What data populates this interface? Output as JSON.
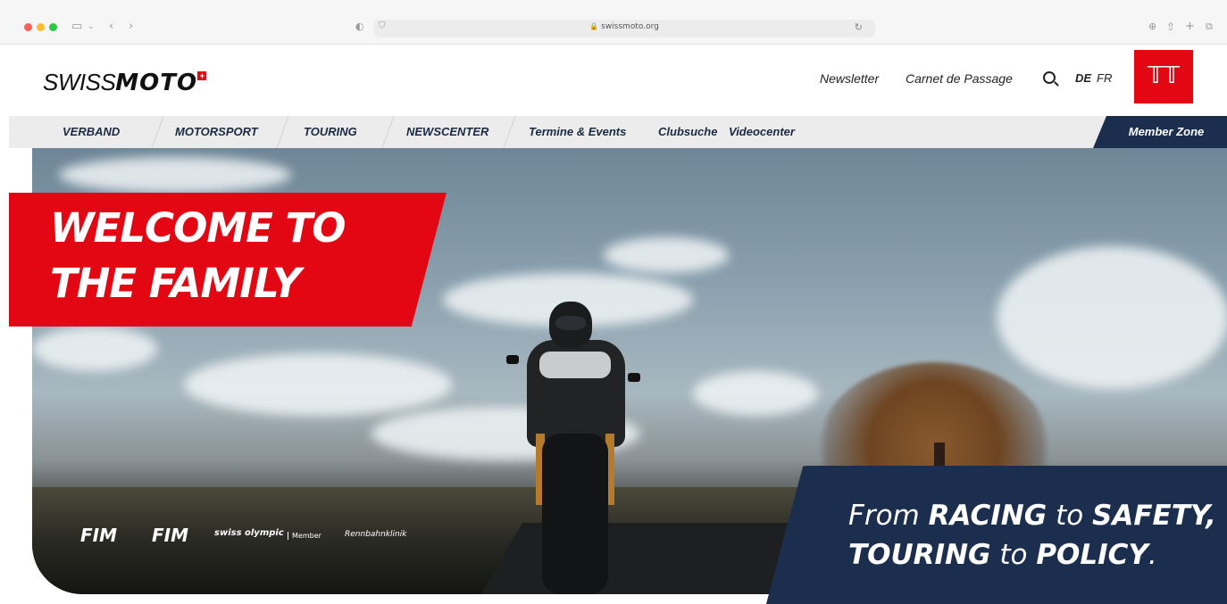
{
  "browser": {
    "url": "swissmoto.org"
  },
  "header": {
    "logo_text_thin": "SWISS",
    "logo_text_bold": "MOTO",
    "logo_plus": "+",
    "links": {
      "newsletter": "Newsletter",
      "carnet": "Carnet de Passage"
    },
    "lang_de": "DE",
    "lang_fr": "FR"
  },
  "nav": {
    "items": [
      "VERBAND",
      "MOTORSPORT",
      "TOURING",
      "NEWSCENTER",
      "Termine & Events",
      "Clubsuche",
      "Videocenter"
    ],
    "member_zone": "Member Zone"
  },
  "hero": {
    "welcome_line1": "WELCOME TO",
    "welcome_line2": "THE FAMILY",
    "partners": {
      "fim1": "FIM",
      "fim2": "FIM",
      "swiss_olympic": "swiss olympic",
      "member": "Member",
      "rennbahn": "Rennbahnklinik"
    },
    "tagline": {
      "from": "From",
      "racing": "RACING",
      "to1": "to",
      "safety": "SAFETY,",
      "touring": "TOURING",
      "to2": "to",
      "policy": "POLICY",
      "period": "."
    }
  },
  "colors": {
    "brand_red": "#e30613",
    "navy": "#1c2e4e"
  }
}
